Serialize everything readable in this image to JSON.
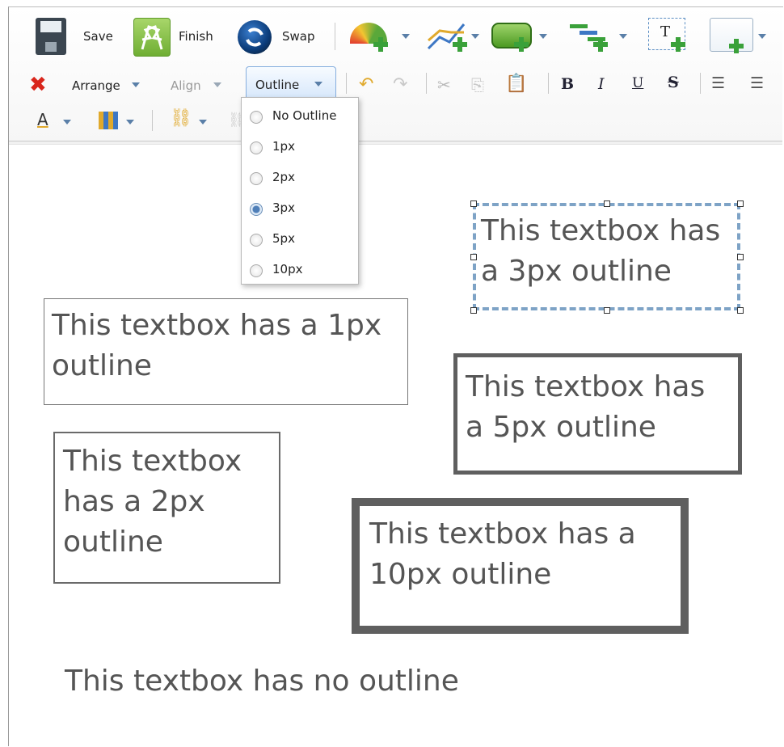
{
  "toolbar": {
    "save_label": "Save",
    "finish_label": "Finish",
    "swap_label": "Swap",
    "insert_textbox_glyph": "T",
    "arrange_label": "Arrange",
    "align_label": "Align",
    "outline_label": "Outline",
    "bold_glyph": "B",
    "italic_glyph": "I",
    "underline_glyph": "U",
    "strike_glyph": "S",
    "font_color_glyph": "A",
    "icons": [
      "save-icon",
      "finish-flags-icon",
      "swap-icon",
      "gauge-icon",
      "line-chart-icon",
      "shape-icon",
      "tree-chart-icon",
      "insert-textbox-icon",
      "frame-icon",
      "delete-icon",
      "undo-icon",
      "redo-icon",
      "cut-icon",
      "copy-icon",
      "paste-icon",
      "numbered-list-icon",
      "bullet-list-icon",
      "font-color-icon",
      "fill-icon",
      "link-icon"
    ],
    "colors": {
      "accent": "#5a7fa8",
      "delete": "#d9261c",
      "add": "#3aa13a"
    }
  },
  "outline_menu": {
    "options": [
      "No Outline",
      "1px",
      "2px",
      "3px",
      "5px",
      "10px"
    ],
    "selected": "3px"
  },
  "canvas": {
    "textboxes": [
      {
        "line1": "This textbox has",
        "line2": "a 3px outline",
        "selected": true
      },
      {
        "line1": "This textbox has a 1px",
        "line2": "outline"
      },
      {
        "line1": "This textbox has",
        "line2": "a 5px outline"
      },
      {
        "line1": "This textbox",
        "line2": "has a 2px",
        "line3": "outline"
      },
      {
        "line1": "This textbox has a",
        "line2": "10px outline"
      },
      {
        "line1": "This textbox has no outline"
      }
    ]
  }
}
